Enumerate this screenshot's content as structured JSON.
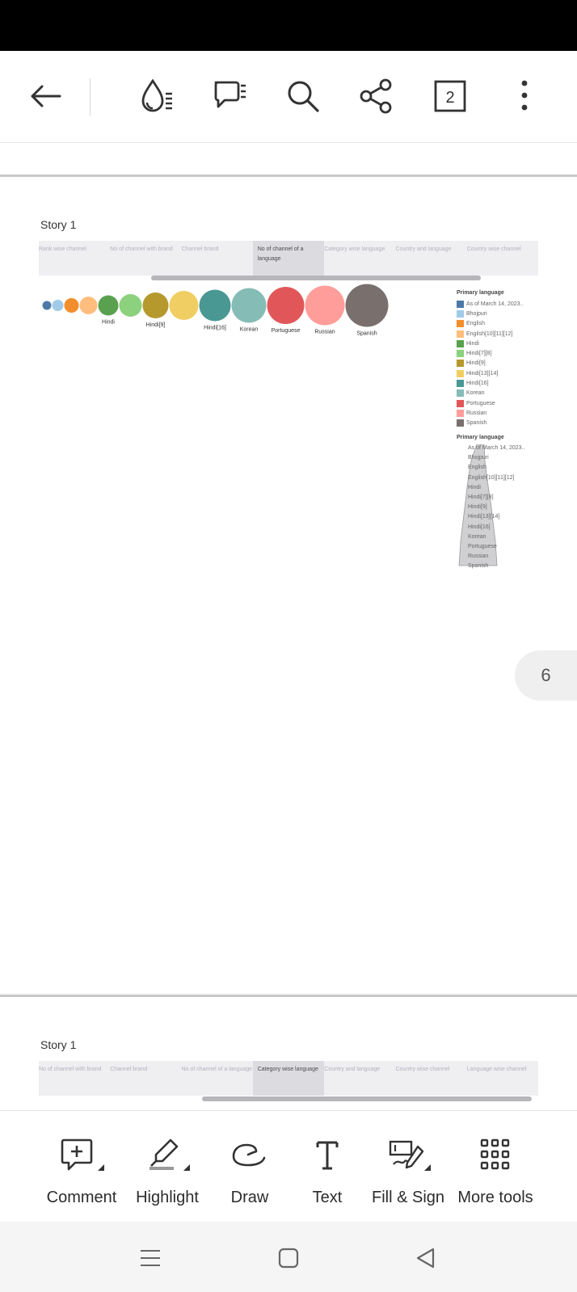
{
  "toolbar": {
    "page_count": "2",
    "icons": [
      "back-arrow-icon",
      "reading-mode-icon",
      "comments-list-icon",
      "search-icon",
      "share-icon",
      "page-count-icon",
      "more-options-icon"
    ]
  },
  "page1": {
    "story_title": "Story 1",
    "tabs": [
      {
        "label": "Rank wise channel",
        "active": false
      },
      {
        "label": "No of channel with brand",
        "active": false
      },
      {
        "label": "Channel brand",
        "active": false
      },
      {
        "label": "No of channel of a language",
        "active": true
      },
      {
        "label": "Category wise language",
        "active": false
      },
      {
        "label": "Country and language",
        "active": false
      },
      {
        "label": "Country wise channel",
        "active": false
      }
    ],
    "bubbles": [
      {
        "label": "",
        "color": "#4e79a7"
      },
      {
        "label": "",
        "color": "#a0cbe8"
      },
      {
        "label": "",
        "color": "#f28e2b"
      },
      {
        "label": "",
        "color": "#ffbe7d"
      },
      {
        "label": "Hindi",
        "color": "#59a14f"
      },
      {
        "label": "",
        "color": "#8cd17d"
      },
      {
        "label": "Hindi[9]",
        "color": "#b6992d"
      },
      {
        "label": "",
        "color": "#f1ce63"
      },
      {
        "label": "Hindi[16]",
        "color": "#499894"
      },
      {
        "label": "Korean",
        "color": "#86bcb6"
      },
      {
        "label": "Portuguese",
        "color": "#e15759"
      },
      {
        "label": "Russian",
        "color": "#ff9d9a"
      },
      {
        "label": "Spanish",
        "color": "#79706e"
      }
    ],
    "legend_title": "Primary language",
    "legend": [
      {
        "label": "As of March 14, 2023..",
        "color": "#4e79a7"
      },
      {
        "label": "Bhojpuri",
        "color": "#a0cbe8"
      },
      {
        "label": "English",
        "color": "#f28e2b"
      },
      {
        "label": "English[10][11][12]",
        "color": "#ffbe7d"
      },
      {
        "label": "Hindi",
        "color": "#59a14f"
      },
      {
        "label": "Hindi[7][8]",
        "color": "#8cd17d"
      },
      {
        "label": "Hindi[9]",
        "color": "#b6992d"
      },
      {
        "label": "Hindi[13][14]",
        "color": "#f1ce63"
      },
      {
        "label": "Hindi[16]",
        "color": "#499894"
      },
      {
        "label": "Korean",
        "color": "#86bcb6"
      },
      {
        "label": "Portuguese",
        "color": "#e15759"
      },
      {
        "label": "Russian",
        "color": "#ff9d9a"
      },
      {
        "label": "Spanish",
        "color": "#79706e"
      }
    ],
    "legend2_title": "Primary language",
    "legend2": [
      "As of March 14, 2023..",
      "Bhojpuri",
      "English",
      "English[10][11][12]",
      "Hindi",
      "Hindi[7][8]",
      "Hindi[9]",
      "Hindi[13][14]",
      "Hindi[16]",
      "Korean",
      "Portuguese",
      "Russian",
      "Spanish"
    ]
  },
  "page_badge": "6",
  "page2": {
    "story_title": "Story 1",
    "tabs": [
      {
        "label": "No of channel with brand",
        "active": false
      },
      {
        "label": "Channel brand",
        "active": false
      },
      {
        "label": "No of channel of a language",
        "active": false
      },
      {
        "label": "Category wise language",
        "active": true
      },
      {
        "label": "Country and language",
        "active": false
      },
      {
        "label": "Country wise channel",
        "active": false
      },
      {
        "label": "Language wise channel",
        "active": false
      }
    ]
  },
  "bottom_tools": [
    {
      "label": "Comment",
      "icon": "comment-icon"
    },
    {
      "label": "Highlight",
      "icon": "highlight-icon"
    },
    {
      "label": "Draw",
      "icon": "draw-icon"
    },
    {
      "label": "Text",
      "icon": "text-icon"
    },
    {
      "label": "Fill & Sign",
      "icon": "fill-sign-icon"
    },
    {
      "label": "More tools",
      "icon": "more-tools-icon"
    }
  ],
  "nav": [
    "recents-icon",
    "home-icon",
    "back-icon"
  ]
}
